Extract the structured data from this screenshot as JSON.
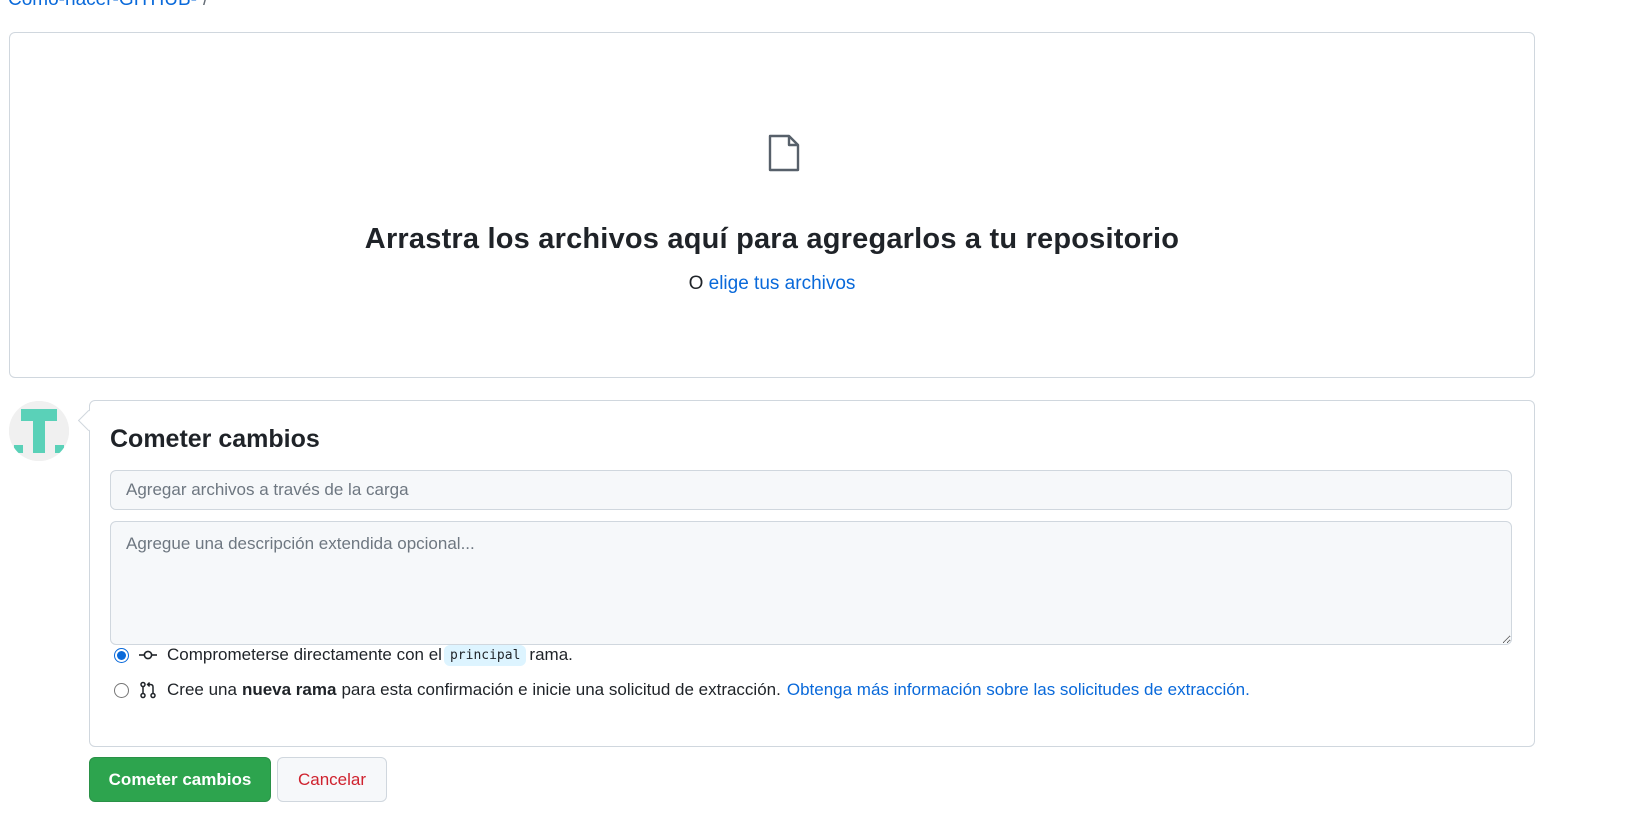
{
  "breadcrumb": {
    "repo": "Como-hacer-GITHUB-",
    "separator": "/"
  },
  "dropzone": {
    "icon": "file-icon",
    "title": "Arrastra los archivos aquí para agregarlos a tu repositorio",
    "prefix": "O",
    "choose_link": "elige tus archivos"
  },
  "avatar": {
    "colors": {
      "primary": "#5ad1b8",
      "background": "#f0f0f0"
    }
  },
  "commit": {
    "title": "Cometer cambios",
    "summary_placeholder": "Agregar archivos a través de la carga",
    "description_placeholder": "Agregue una descripción extendida opcional...",
    "option_direct": {
      "text_before": "Comprometerse directamente con el",
      "branch": "principal",
      "text_after": "rama.",
      "selected": true,
      "icon": "git-commit-icon"
    },
    "option_new_branch": {
      "text_before": "Cree una",
      "bold": "nueva rama",
      "text_after": "para esta confirmación e inicie una solicitud de extracción.",
      "link": "Obtenga más información sobre las solicitudes de extracción.",
      "selected": false,
      "icon": "git-pull-request-icon"
    }
  },
  "buttons": {
    "commit": "Cometer cambios",
    "cancel": "Cancelar"
  },
  "colors": {
    "link": "#0969da",
    "primary_button": "#2da44e",
    "danger_text": "#cf222e",
    "border": "#d0d7de"
  }
}
